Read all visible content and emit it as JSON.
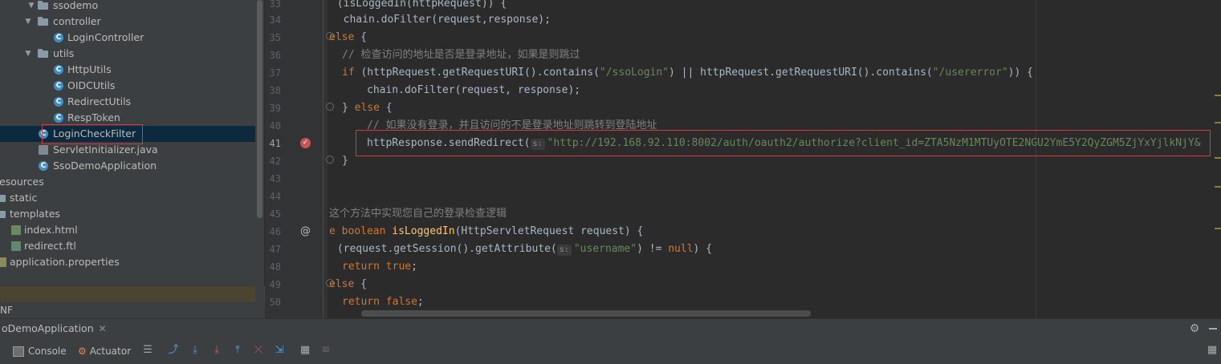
{
  "project_tree": {
    "items": [
      {
        "label": "ssodemo",
        "kind": "folder"
      },
      {
        "label": "controller",
        "kind": "folder"
      },
      {
        "label": "LoginController",
        "kind": "class"
      },
      {
        "label": "utils",
        "kind": "folder"
      },
      {
        "label": "HttpUtils",
        "kind": "class"
      },
      {
        "label": "OIDCUtils",
        "kind": "class"
      },
      {
        "label": "RedirectUtils",
        "kind": "class"
      },
      {
        "label": "RespToken",
        "kind": "class"
      },
      {
        "label": "LoginCheckFilter",
        "kind": "class"
      },
      {
        "label": "ServletInitializer.java",
        "kind": "java"
      },
      {
        "label": "SsoDemoApplication",
        "kind": "spring"
      },
      {
        "label": "esources",
        "kind": "folder"
      },
      {
        "label": "static",
        "kind": "folder"
      },
      {
        "label": "templates",
        "kind": "folder"
      },
      {
        "label": "index.html",
        "kind": "html"
      },
      {
        "label": "redirect.ftl",
        "kind": "ftl"
      },
      {
        "label": "application.properties",
        "kind": "props"
      },
      {
        "label": "NF",
        "kind": "folder"
      }
    ]
  },
  "editor": {
    "lines": [
      {
        "no": "33",
        "text": " (isLoggedIn(httpRequest)) {"
      },
      {
        "no": "34",
        "text": "  chain.doFilter(request,response);"
      },
      {
        "no": "35",
        "kw": "else",
        "text": " {"
      },
      {
        "no": "36",
        "comment": "// 检查访问的地址是否是登录地址，如果是则跳过"
      },
      {
        "no": "37",
        "kw": "if",
        "pre": " (httpRequest.getRequestURI().contains(",
        "s1": "\"/ssoLogin\"",
        "mid": ") || httpRequest.getRequestURI().contains(",
        "s2": "\"/usererror\"",
        "post": ")) {"
      },
      {
        "no": "38",
        "text": "chain.doFilter(request, response);"
      },
      {
        "no": "39",
        "pre": "} ",
        "kw": "else",
        "text": " {"
      },
      {
        "no": "40",
        "comment": "// 如果没有登录，并且访问的不是登录地址则跳转到登陆地址"
      },
      {
        "no": "41",
        "pre": "httpResponse.sendRedirect(",
        "hint": "s:",
        "str": "\"http://192.168.92.110:8002/auth/oauth2/authorize?client_id=ZTA5NzM1MTUyOTE2NGU2YmE5Y2QyZGM5ZjYxYjlkNjY&"
      },
      {
        "no": "42",
        "text": "}"
      },
      {
        "no": "43",
        "text": ""
      },
      {
        "no": "44",
        "text": ""
      },
      {
        "no": "45",
        "comment": "这个方法中实现您自己的登录检查逻辑"
      },
      {
        "no": "46",
        "kw": "e boolean",
        "fn": "isLoggedIn",
        "text": "(HttpServletRequest request) {"
      },
      {
        "no": "47",
        "pre": " (request.getSession().getAttribute(",
        "hint": "s:",
        "str": "\"username\"",
        "post": ") != ",
        "kw": "null",
        "end": ") {"
      },
      {
        "no": "48",
        "kw": "return true",
        "text": ";"
      },
      {
        "no": "49",
        "kw": "else",
        "text": " {"
      },
      {
        "no": "50",
        "kw": "return false",
        "text": ";"
      }
    ],
    "gutter_marks": {
      "breakpoint_line": "41",
      "override_line": "46",
      "override_symbol": "@"
    }
  },
  "run_panel": {
    "tab_label": "oDemoApplication",
    "close_symbol": "✕",
    "toolbar": {
      "console_label": "Console",
      "actuator_label": "Actuator"
    }
  },
  "colors": {
    "keyword": "#cc7832",
    "string": "#6a8759",
    "comment": "#808080",
    "method": "#ffc66d",
    "highlight_box": "#d9363e",
    "selection": "#0d293e"
  }
}
